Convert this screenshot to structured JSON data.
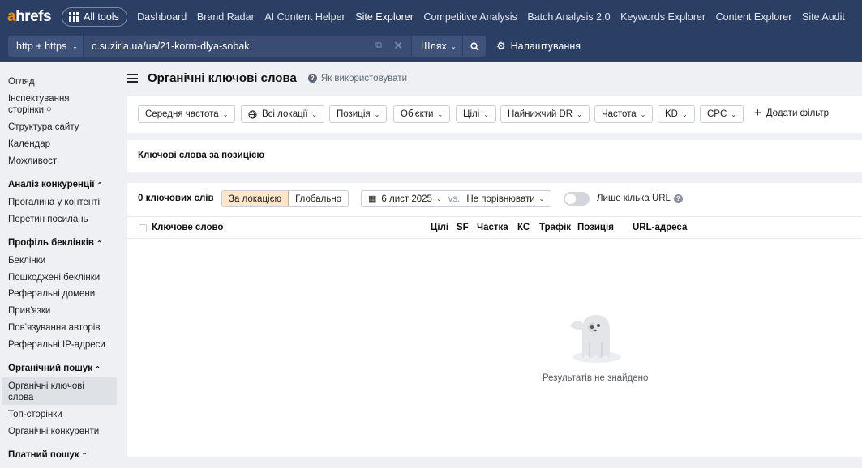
{
  "app": {
    "logo_prefix": "a",
    "logo_rest": "hrefs"
  },
  "topnav": {
    "all_tools": "All tools",
    "links": [
      "Dashboard",
      "Brand Radar",
      "AI Content Helper",
      "Site Explorer",
      "Competitive Analysis",
      "Batch Analysis 2.0",
      "Keywords Explorer",
      "Content Explorer",
      "Site Audit"
    ],
    "active": "Site Explorer"
  },
  "urlbar": {
    "protocol": "http + https",
    "url": "c.suzirla.ua/ua/21-korm-dlya-sobak",
    "mode": "Шлях",
    "settings": "Налаштування"
  },
  "sidebar": {
    "top_items": [
      "Огляд",
      "Інспектування сторінки",
      "Структура сайту",
      "Календар",
      "Можливості"
    ],
    "sections": [
      {
        "title": "Аналіз конкуренції",
        "items": [
          "Прогалина у контенті",
          "Перетин посилань"
        ]
      },
      {
        "title": "Профіль беклінків",
        "items": [
          "Беклінки",
          "Пошкоджені беклінки",
          "Реферальні домени",
          "Прив'язки",
          "Пов'язування авторів",
          "Реферальні IP-адреси"
        ]
      },
      {
        "title": "Органічний пошук",
        "items": [
          "Органічні ключові слова",
          "Топ-сторінки",
          "Органічні конкуренти"
        ]
      },
      {
        "title": "Платний пошук",
        "items": []
      }
    ],
    "active_item": "Органічні ключові слова"
  },
  "page": {
    "title": "Органічні ключові слова",
    "howto": "Як використовувати"
  },
  "filters": {
    "buttons": [
      "Середня частота",
      "Всі локації",
      "Позиція",
      "Об'єкти",
      "Цілі",
      "Найнижчий DR",
      "Частота",
      "KD",
      "CPC"
    ],
    "add_filter": "Додати фільтр"
  },
  "tabs": {
    "label": "Ключові слова за позицією"
  },
  "results": {
    "count": "0 ключових слів",
    "scope_options": [
      "За локацією",
      "Глобально"
    ],
    "scope_selected": "За локацією",
    "date": "6 лист 2025",
    "vs": "vs.",
    "compare": "Не порівнювати",
    "few_url": "Лише кілька URL",
    "columns": [
      "Ключове слово",
      "Цілі",
      "SF",
      "Частка",
      "КС",
      "Трафік",
      "Позиція",
      "URL-адреса"
    ],
    "empty_text": "Результатів не знайдено"
  },
  "colors": {
    "nav_bg": "#2b3e63",
    "accent": "#ff8800",
    "active_bg": "#dee1e6",
    "seg_on": "#fde6cc"
  }
}
